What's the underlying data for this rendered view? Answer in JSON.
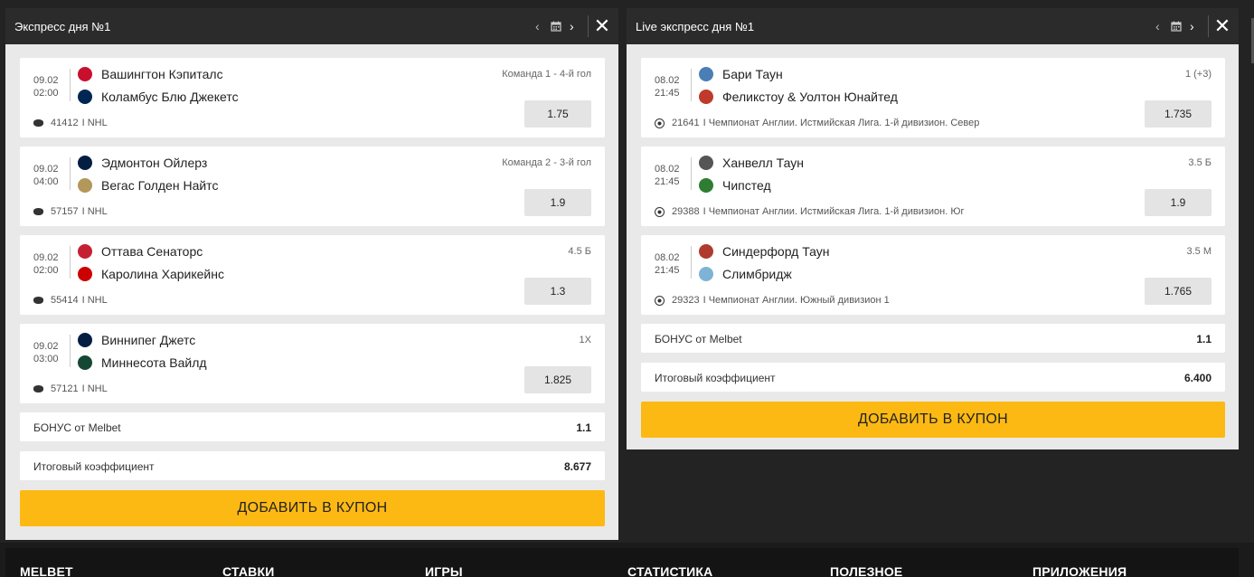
{
  "left": {
    "title": "Экспресс дня №1",
    "events": [
      {
        "date": "09.02",
        "time": "02:00",
        "home": "Вашингтон Кэпиталс",
        "away": "Коламбус Блю Джекетс",
        "market": "Команда 1 - 4-й гол",
        "odd": "1.75",
        "id": "41412",
        "league": "I NHL",
        "home_color": "#c8102e",
        "away_color": "#002654"
      },
      {
        "date": "09.02",
        "time": "04:00",
        "home": "Эдмонтон Ойлерз",
        "away": "Вегас Голден Найтс",
        "market": "Команда 2 - 3-й гол",
        "odd": "1.9",
        "id": "57157",
        "league": "I NHL",
        "home_color": "#041e42",
        "away_color": "#b4975a"
      },
      {
        "date": "09.02",
        "time": "02:00",
        "home": "Оттава Сенаторс",
        "away": "Каролина Харикейнс",
        "market": "4.5 Б",
        "odd": "1.3",
        "id": "55414",
        "league": "I NHL",
        "home_color": "#c52032",
        "away_color": "#cc0000"
      },
      {
        "date": "09.02",
        "time": "03:00",
        "home": "Виннипег Джетс",
        "away": "Миннесота Вайлд",
        "market": "1X",
        "odd": "1.825",
        "id": "57121",
        "league": "I NHL",
        "home_color": "#041e42",
        "away_color": "#154734"
      }
    ],
    "bonus_label": "БОНУС от Melbet",
    "bonus_value": "1.1",
    "total_label": "Итоговый коэффициент",
    "total_value": "8.677",
    "add_label": "ДОБАВИТЬ В КУПОН"
  },
  "right": {
    "title": "Live экспресс дня №1",
    "events": [
      {
        "date": "08.02",
        "time": "21:45",
        "home": "Бари Таун",
        "away": "Феликстоу & Уолтон Юнайтед",
        "market": "1 (+3)",
        "odd": "1.735",
        "id": "21641",
        "league": "I Чемпионат Англии. Истмийская Лига. 1-й дивизион. Север",
        "home_color": "#4a7fb5",
        "away_color": "#c0392b"
      },
      {
        "date": "08.02",
        "time": "21:45",
        "home": "Ханвелл Таун",
        "away": "Чипстед",
        "market": "3.5 Б",
        "odd": "1.9",
        "id": "29388",
        "league": "I Чемпионат Англии. Истмийская Лига. 1-й дивизион. Юг",
        "home_color": "#555555",
        "away_color": "#2e7d32"
      },
      {
        "date": "08.02",
        "time": "21:45",
        "home": "Синдерфорд Таун",
        "away": "Слимбридж",
        "market": "3.5 М",
        "odd": "1.765",
        "id": "29323",
        "league": "I Чемпионат Англии. Южный дивизион 1",
        "home_color": "#b03a2e",
        "away_color": "#7fb3d5"
      }
    ],
    "bonus_label": "БОНУС от Melbet",
    "bonus_value": "1.1",
    "total_label": "Итоговый коэффициент",
    "total_value": "6.400",
    "add_label": "ДОБАВИТЬ В КУПОН"
  },
  "footer": [
    "MELBET",
    "СТАВКИ",
    "ИГРЫ",
    "СТАТИСТИКА",
    "ПОЛЕЗНОЕ",
    "ПРИЛОЖЕНИЯ"
  ],
  "colors": {
    "accent": "#fdb913",
    "header_bg": "#2b2b2b",
    "panel_bg": "#e9e9e9"
  }
}
